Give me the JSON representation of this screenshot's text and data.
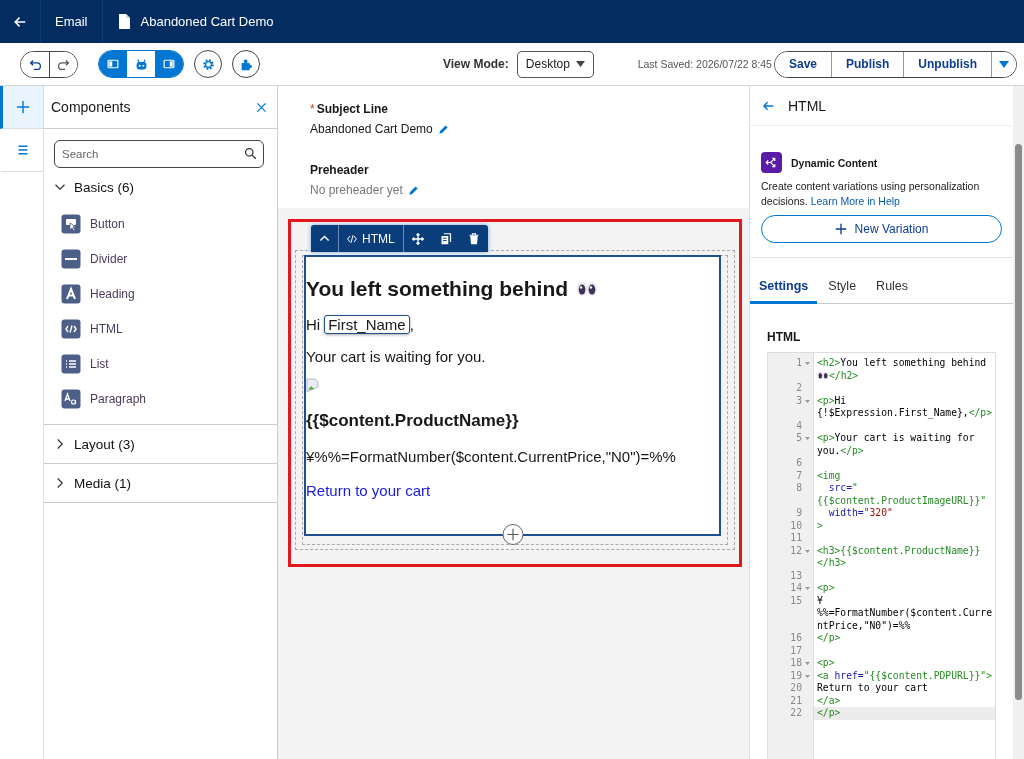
{
  "top_bar": {
    "section": "Email",
    "document": "Abandoned Cart Demo"
  },
  "toolbar": {
    "panel_toggles": [
      {
        "selected": true
      },
      {
        "selected": false
      },
      {
        "selected": true
      }
    ],
    "view_mode_label": "View Mode:",
    "view_mode": "Desktop",
    "last_saved": "Last Saved: 2026/07/22 8:45",
    "actions": [
      "Save",
      "Publish",
      "Unpublish"
    ]
  },
  "rail": [
    {
      "selected": true
    },
    {
      "selected": false
    }
  ],
  "components_panel": {
    "title": "Components",
    "search_placeholder": "Search",
    "groups": [
      {
        "label": "Basics (6)",
        "expanded": true,
        "items": [
          {
            "label": "Button",
            "kind": "button"
          },
          {
            "label": "Divider",
            "kind": "divider"
          },
          {
            "label": "Heading",
            "kind": "heading"
          },
          {
            "label": "HTML",
            "kind": "html"
          },
          {
            "label": "List",
            "kind": "list"
          },
          {
            "label": "Paragraph",
            "kind": "paragraph"
          }
        ]
      },
      {
        "label": "Layout (3)",
        "expanded": false
      },
      {
        "label": "Media (1)",
        "expanded": false
      }
    ]
  },
  "subject": {
    "required_mark": "*",
    "label": "Subject Line",
    "value": "Abandoned Cart Demo"
  },
  "preheader": {
    "label": "Preheader",
    "empty_text": "No preheader yet"
  },
  "block_toolbar": {
    "label": "HTML"
  },
  "email": {
    "heading": "You left something behind",
    "greeting": "Hi",
    "merge_field": "First_Name",
    "greeting_end": ",",
    "body": "Your cart is waiting for you.",
    "product": "{{$content.ProductName}}",
    "price": "¥%%=FormatNumber($content.CurrentPrice,\"N0\")=%%",
    "link": "Return to your cart"
  },
  "right_panel": {
    "title": "HTML",
    "dynamic_title": "Dynamic Content",
    "dynamic_description": "Create content variations using personalization decisions.",
    "help_link": "Learn More in Help",
    "new_variation": "New Variation",
    "tabs": [
      {
        "label": "Settings",
        "selected": true
      },
      {
        "label": "Style",
        "selected": false
      },
      {
        "label": "Rules",
        "selected": false
      }
    ],
    "section_label": "HTML",
    "code": [
      {
        "n": "1",
        "fold": true,
        "tokens": [
          {
            "kind": "tag",
            "text": "<h2>"
          },
          {
            "kind": "text",
            "text": "You left something behind "
          },
          {
            "kind": "emoji"
          },
          {
            "kind": "tag",
            "text": "</h2>"
          }
        ]
      },
      {
        "n": "2",
        "fold": false
      },
      {
        "n": "3",
        "fold": true,
        "tokens": [
          {
            "kind": "tag",
            "text": "<p>"
          },
          {
            "kind": "text",
            "text": "Hi {!$Expression.First_Name},"
          },
          {
            "kind": "tag",
            "text": "</p>"
          }
        ]
      },
      {
        "n": "4",
        "fold": false
      },
      {
        "n": "5",
        "fold": true,
        "tokens": [
          {
            "kind": "tag",
            "text": "<p>"
          },
          {
            "kind": "text",
            "text": "Your cart is waiting for you."
          },
          {
            "kind": "tag",
            "text": "</p>"
          }
        ]
      },
      {
        "n": "6",
        "fold": false
      },
      {
        "n": "7",
        "fold": false,
        "tokens": [
          {
            "kind": "tag",
            "text": "<img"
          }
        ]
      },
      {
        "n": "8",
        "fold": false,
        "tokens": [
          {
            "kind": "attribute",
            "text": "  src="
          },
          {
            "kind": "value",
            "text": "\""
          },
          {
            "kind": "value",
            "text": "{{$content.ProductImageURL}}\""
          }
        ]
      },
      {
        "n": "9",
        "fold": false,
        "tokens": [
          {
            "kind": "attribute",
            "text": "  width="
          },
          {
            "kind": "literal",
            "text": "\"320\""
          }
        ]
      },
      {
        "n": "10",
        "fold": false,
        "tokens": [
          {
            "kind": "tag",
            "text": ">"
          }
        ]
      },
      {
        "n": "11",
        "fold": false
      },
      {
        "n": "12",
        "fold": true,
        "tokens": [
          {
            "kind": "tag",
            "text": "<h3>"
          },
          {
            "kind": "value",
            "text": "{{$content.ProductName}}"
          },
          {
            "kind": "tag",
            "text": "</h3>"
          }
        ]
      },
      {
        "n": "13",
        "fold": false
      },
      {
        "n": "14",
        "fold": true,
        "tokens": [
          {
            "kind": "tag",
            "text": "<p>"
          }
        ]
      },
      {
        "n": "15",
        "fold": false,
        "tokens": [
          {
            "kind": "text",
            "text": "¥"
          },
          {
            "kind": "text",
            "text": "%%=FormatNumber($content.CurrentPrice,\"N0\")=%%"
          }
        ]
      },
      {
        "n": "16",
        "fold": false,
        "tokens": [
          {
            "kind": "tag",
            "text": "</p>"
          }
        ]
      },
      {
        "n": "17",
        "fold": false
      },
      {
        "n": "18",
        "fold": true,
        "tokens": [
          {
            "kind": "tag",
            "text": "<p>"
          }
        ]
      },
      {
        "n": "19",
        "fold": true,
        "tokens": [
          {
            "kind": "tag",
            "text": "<a "
          },
          {
            "kind": "attribute",
            "text": "href="
          },
          {
            "kind": "value",
            "text": "\"{{$content.PDPURL}}\">"
          }
        ]
      },
      {
        "n": "20",
        "fold": false,
        "tokens": [
          {
            "kind": "text",
            "text": "Return to your cart"
          }
        ]
      },
      {
        "n": "21",
        "fold": false,
        "tokens": [
          {
            "kind": "tag",
            "text": "</a>"
          }
        ]
      },
      {
        "n": "22",
        "fold": false,
        "active": true,
        "tokens": [
          {
            "kind": "tag",
            "text": "</p>"
          }
        ]
      }
    ]
  }
}
